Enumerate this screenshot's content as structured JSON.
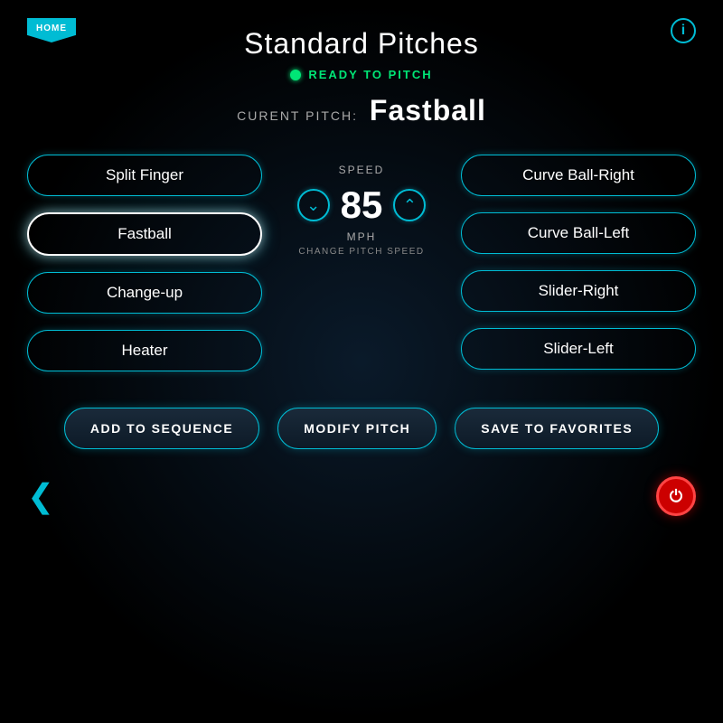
{
  "header": {
    "home_label": "HOME",
    "title": "Standard Pitches",
    "info_icon": "i",
    "ready_status": "READY TO PITCH",
    "current_pitch_label": "CURENT PITCH:",
    "current_pitch_value": "Fastball"
  },
  "speed": {
    "label": "SPEED",
    "value": "85",
    "unit": "MPH",
    "sublabel": "CHANGE PITCH SPEED"
  },
  "left_pitches": [
    {
      "id": "split-finger",
      "label": "Split Finger",
      "selected": false
    },
    {
      "id": "fastball",
      "label": "Fastball",
      "selected": true
    },
    {
      "id": "change-up",
      "label": "Change-up",
      "selected": false
    },
    {
      "id": "heater",
      "label": "Heater",
      "selected": false
    }
  ],
  "right_pitches": [
    {
      "id": "curve-ball-right",
      "label": "Curve Ball-Right",
      "selected": false
    },
    {
      "id": "curve-ball-left",
      "label": "Curve Ball-Left",
      "selected": false
    },
    {
      "id": "slider-right",
      "label": "Slider-Right",
      "selected": false
    },
    {
      "id": "slider-left",
      "label": "Slider-Left",
      "selected": false
    }
  ],
  "buttons": {
    "add_sequence": "ADD TO SEQUENCE",
    "modify_pitch": "MODIFY PITCH",
    "save_favorites": "SAVE TO FAVORITES"
  },
  "nav": {
    "back_icon": "❮",
    "stop_icon": "⏻"
  }
}
